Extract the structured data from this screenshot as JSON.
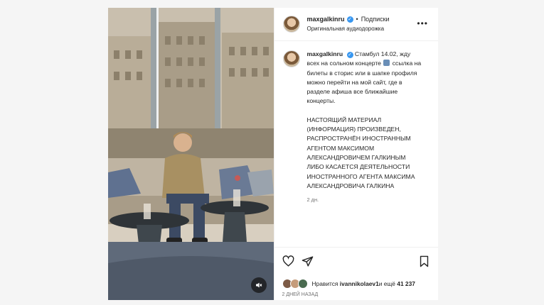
{
  "post": {
    "username": "maxgalkinru",
    "follow_label": "Подписки",
    "audio_label": "Оригинальная аудиодорожка",
    "more_icon": "more-horizontal-icon",
    "caption_part1": "Стамбул 14.02, жду всех на сольном концерте ",
    "caption_part2": " ссылка на билеты в сторис или в шапке профиля можно перейти на мой сайт, где в разделе афиша все ближайшие концерты.",
    "caption_notice": "НАСТОЯЩИЙ МАТЕРИАЛ (ИНФОРМАЦИЯ) ПРОИЗВЕДЕН, РАСПРОСТРАНЁН ИНОСТРАННЫМ АГЕНТОМ МАКСИМОМ АЛЕКСАНДРОВИЧЕМ ГАЛКИНЫМ ЛИБО КАСАЕТСЯ ДЕЯТЕЛЬНОСТИ ИНОСТРАННОГО АГЕНТА МАКСИМА АЛЕКСАНДРОВИЧА ГАЛКИНА",
    "caption_age": "2 дн.",
    "likes_prefix": "Нравится ",
    "likes_user": "ivannikolaev1",
    "likes_suffix": " и ещё ",
    "likes_count": "41 237",
    "post_date": "2 дней назад"
  },
  "icons": {
    "like": "heart-icon",
    "share": "send-icon",
    "save": "bookmark-icon",
    "mute": "speaker-muted-icon"
  },
  "colors": {
    "verified": "#3897f0",
    "text": "#262626",
    "secondary": "#737373"
  }
}
